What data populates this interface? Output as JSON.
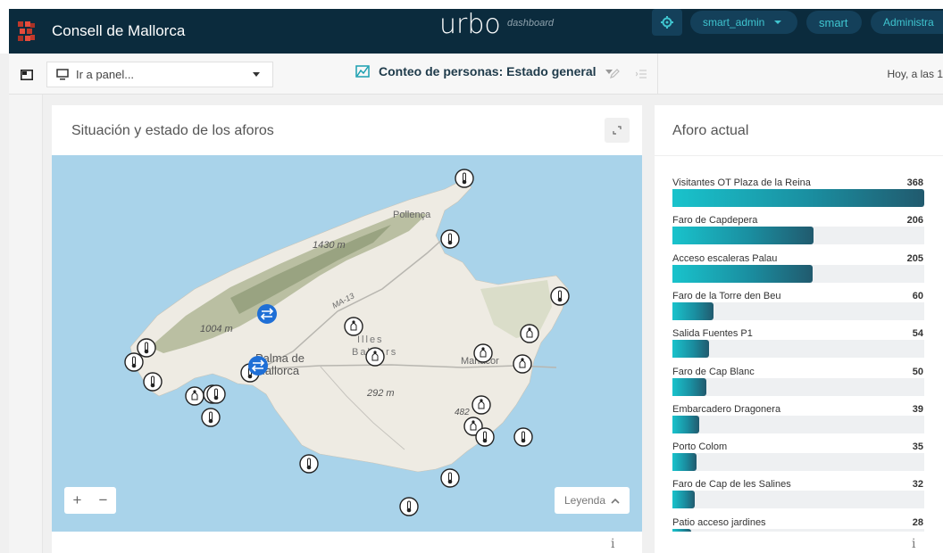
{
  "header": {
    "org_name": "Consell de Mallorca",
    "brand": "urbo",
    "brand_sub": "dashboard",
    "user_label": "smart_admin",
    "tenant_label": "smart",
    "admin_label": "Administra"
  },
  "toolbar": {
    "panel_select_placeholder": "Ir a panel...",
    "dashboard_title": "Conteo de personas: Estado general",
    "time_text": "Hoy, a las 1"
  },
  "map_card": {
    "title": "Situación y estado de los aforos",
    "legend_label": "Leyenda",
    "zoom_in": "+",
    "zoom_out": "−",
    "info": "i",
    "place_labels": {
      "pollenca": "Pollença",
      "peak1": "1430 m",
      "peak2": "1004 m",
      "road": "MA-13",
      "palma1": "Palma de",
      "palma2": "Mallorca",
      "illes1": "Illes",
      "illes2": "Balears",
      "manacor": "Manacor",
      "peak3": "292 m",
      "peak4": "482"
    }
  },
  "bar_card": {
    "title": "Aforo actual",
    "info": "i",
    "max_value": 368,
    "items": [
      {
        "label": "Visitantes OT Plaza de la Reina",
        "value": 368
      },
      {
        "label": "Faro de Capdepera",
        "value": 206
      },
      {
        "label": "Acceso escaleras Palau",
        "value": 205
      },
      {
        "label": "Faro de la Torre den Beu",
        "value": 60
      },
      {
        "label": "Salida Fuentes P1",
        "value": 54
      },
      {
        "label": "Faro de Cap Blanc",
        "value": 50
      },
      {
        "label": "Embarcadero Dragonera",
        "value": 39
      },
      {
        "label": "Porto Colom",
        "value": 35
      },
      {
        "label": "Faro de Cap de les Salines",
        "value": 32
      },
      {
        "label": "Patio acceso jardines",
        "value": 28
      }
    ]
  },
  "colors": {
    "header_bg": "#0b2b3d",
    "accent": "#3fc4cf",
    "bar_start": "#19c3cc",
    "bar_end": "#215a6e",
    "sea": "#a9d3ea",
    "marker_blue": "#1f6fd6"
  },
  "icons": {
    "logo": "consell-logo-icon",
    "settings": "gear-icon",
    "user_caret": "chevron-down-icon",
    "panel_toggle": "sidebar-toggle-icon",
    "monitor": "monitor-icon",
    "dashboard": "chart-icon",
    "edit": "pencil-icon",
    "list": "list-icon",
    "expand": "expand-icon",
    "legend_caret": "chevron-up-icon",
    "sensor": "thermometer-sensor-icon",
    "counter": "people-counter-icon",
    "transfer": "transfer-arrows-icon"
  }
}
